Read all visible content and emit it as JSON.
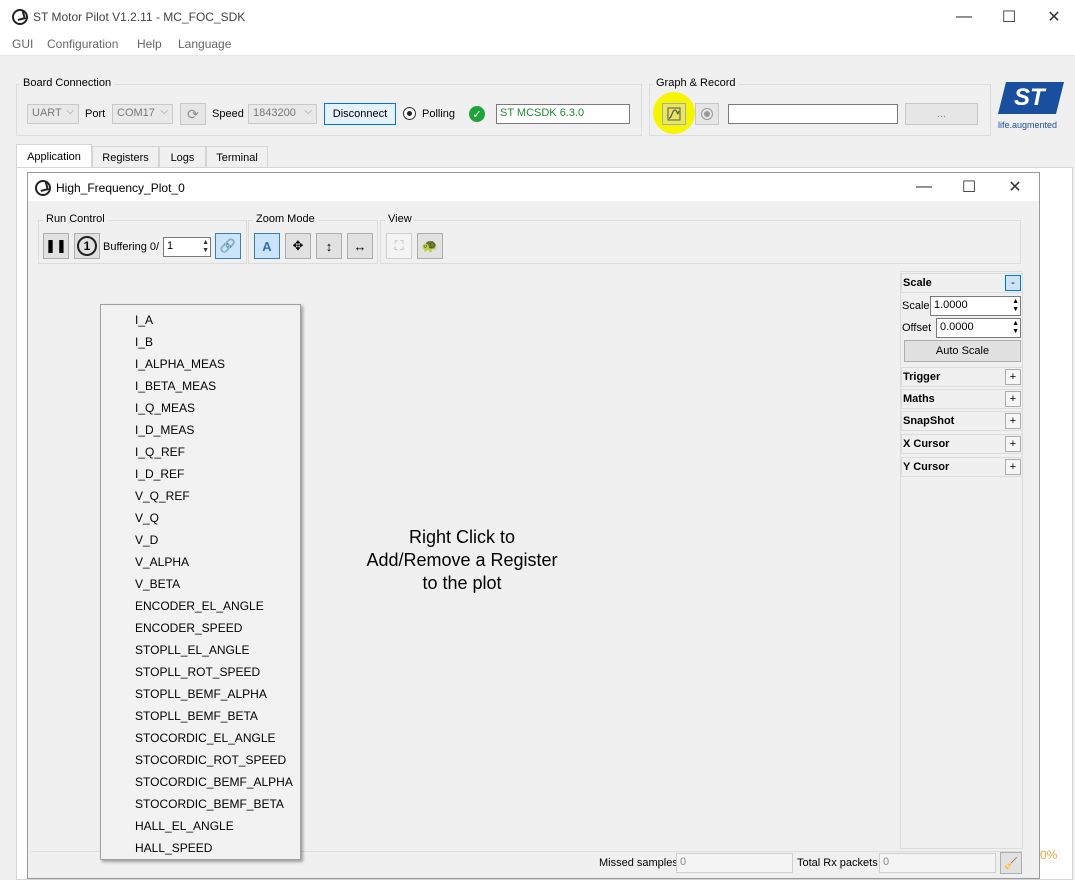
{
  "window": {
    "title": "ST Motor Pilot V1.2.11 - MC_FOC_SDK",
    "controls": {
      "minimize": "—",
      "maximize": "☐",
      "close": "✕"
    }
  },
  "menu": [
    "GUI",
    "Configuration",
    "Help",
    "Language"
  ],
  "board_connection": {
    "title": "Board Connection",
    "protocol": "UART",
    "port_label": "Port",
    "port": "COM17",
    "speed_label": "Speed",
    "speed": "1843200",
    "disconnect_label": "Disconnect",
    "polling_label": "Polling",
    "status_text": "ST MCSDK 6.3.0",
    "status_color": "#1b8a2e"
  },
  "graph_record": {
    "title": "Graph & Record",
    "path_value": "",
    "browse_label": "...",
    "highlight_color": "#f5f500"
  },
  "logo": {
    "text": "ST",
    "tagline": "life.augmented",
    "color": "#1a4fa0"
  },
  "tabs": [
    "Application",
    "Registers",
    "Logs",
    "Terminal"
  ],
  "plot_window": {
    "title": "High_Frequency_Plot_0",
    "controls": {
      "minimize": "—",
      "maximize": "☐",
      "close": "✕"
    },
    "run_control": {
      "title": "Run Control",
      "buffering_label": "Buffering 0/",
      "buffering_value": "1"
    },
    "zoom_mode": {
      "title": "Zoom Mode"
    },
    "view": {
      "title": "View"
    },
    "scale_panel": {
      "title": "Scale",
      "collapse": "-",
      "scale_label": "Scale",
      "scale_value": "1.0000",
      "offset_label": "Offset",
      "offset_value": "0.0000",
      "auto_scale_label": "Auto Scale"
    },
    "panels": [
      {
        "label": "Trigger",
        "toggle": "+"
      },
      {
        "label": "Maths",
        "toggle": "+"
      },
      {
        "label": "SnapShot",
        "toggle": "+"
      },
      {
        "label": "X Cursor",
        "toggle": "+"
      },
      {
        "label": "Y Cursor",
        "toggle": "+"
      }
    ],
    "hint": [
      "Right Click to",
      "Add/Remove a Register",
      "to the plot"
    ],
    "status": {
      "missed_label": "Missed samples",
      "missed_value": "0",
      "rx_label": "Total Rx packets",
      "rx_value": "0"
    }
  },
  "register_menu": [
    "I_A",
    "I_B",
    "I_ALPHA_MEAS",
    "I_BETA_MEAS",
    "I_Q_MEAS",
    "I_D_MEAS",
    "I_Q_REF",
    "I_D_REF",
    "V_Q_REF",
    "V_Q",
    "V_D",
    "V_ALPHA",
    "V_BETA",
    "ENCODER_EL_ANGLE",
    "ENCODER_SPEED",
    "STOPLL_EL_ANGLE",
    "STOPLL_ROT_SPEED",
    "STOPLL_BEMF_ALPHA",
    "STOPLL_BEMF_BETA",
    "STOCORDIC_EL_ANGLE",
    "STOCORDIC_ROT_SPEED",
    "STOCORDIC_BEMF_ALPHA",
    "STOCORDIC_BEMF_BETA",
    "HALL_EL_ANGLE",
    "HALL_SPEED"
  ],
  "edge_fragment": "0%"
}
